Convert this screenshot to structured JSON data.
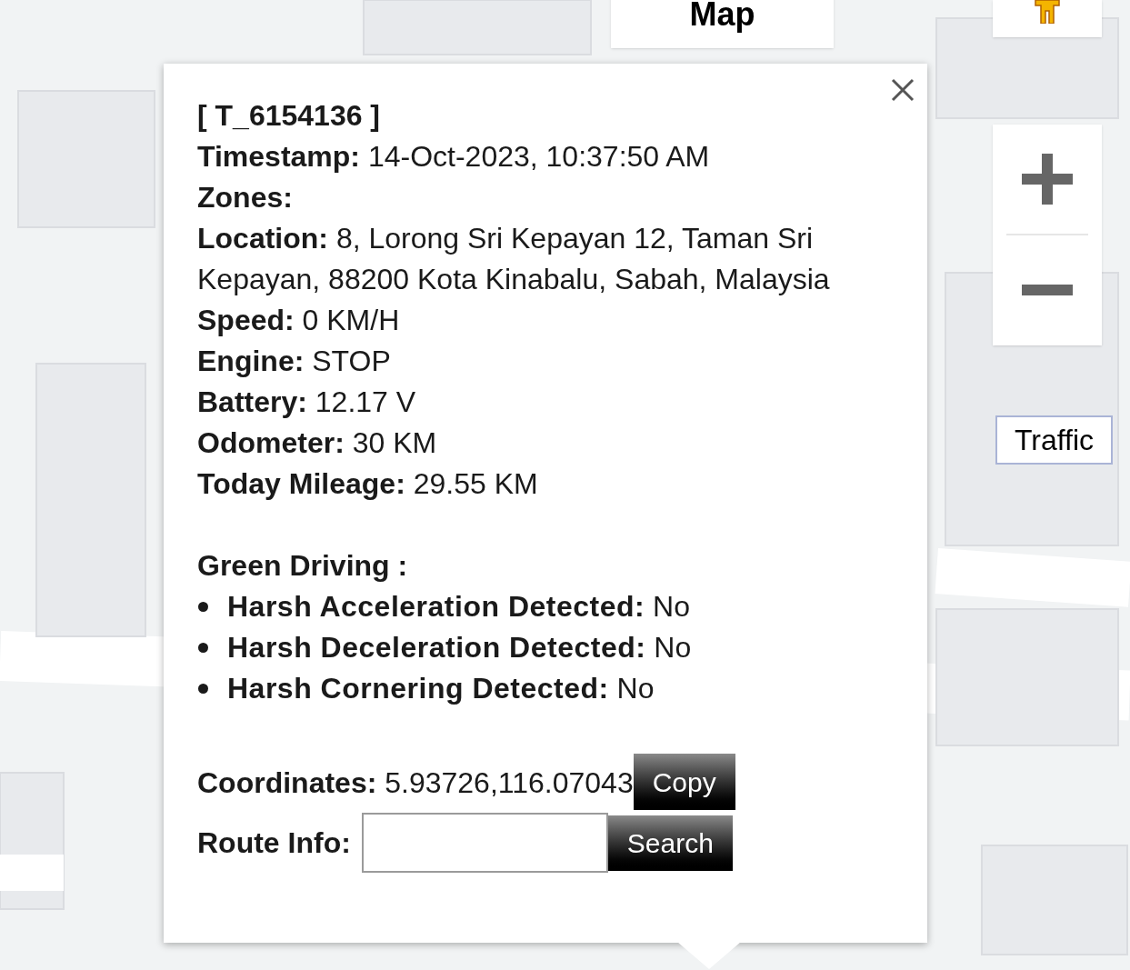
{
  "map_type_button": {
    "label": "Map"
  },
  "traffic_button": {
    "label": "Traffic"
  },
  "popup": {
    "title": "[ T_6154136 ]",
    "fields": [
      {
        "label": "Timestamp:",
        "value": "14-Oct-2023, 10:37:50 AM"
      },
      {
        "label": "Zones:"
      },
      {
        "label": "Location:",
        "value": "8, Lorong Sri Kepayan 12, Taman Sri Kepayan, 88200 Kota Kinabalu, Sabah, Malaysia"
      },
      {
        "label": "Speed:",
        "value": "0 KM/H"
      },
      {
        "label": "Engine:",
        "value": "STOP"
      },
      {
        "label": "Battery:",
        "value": "12.17 V"
      },
      {
        "label": "Odometer:",
        "value": "30 KM"
      },
      {
        "label": "Today Mileage:",
        "value": "29.55 KM"
      }
    ],
    "green_driving": {
      "heading": "Green Driving :",
      "items": [
        {
          "label": "Harsh Acceleration Detected:",
          "value": "No"
        },
        {
          "label": "Harsh Deceleration Detected:",
          "value": "No"
        },
        {
          "label": "Harsh Cornering Detected:",
          "value": "No"
        }
      ]
    },
    "coordinates": {
      "label": "Coordinates:",
      "value": "5.93726,116.07043",
      "button": "Copy"
    },
    "route_info": {
      "label": "Route Info:",
      "button": "Search"
    }
  }
}
